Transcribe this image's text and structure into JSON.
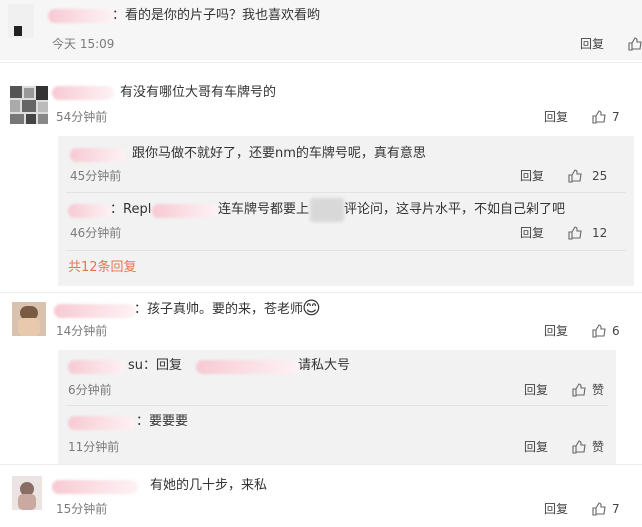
{
  "top_comment": {
    "text": "：看的是你的片子吗？我也喜欢看哟",
    "time": "今天 15:09",
    "reply_label": "回复"
  },
  "comments": [
    {
      "text": "有没有哪位大哥有车牌号的",
      "time": "54分钟前",
      "reply_label": "回复",
      "likes": "7",
      "replies": [
        {
          "text": "跟你马做不就好了，还要nm的车牌号呢，真有意思",
          "time": "45分钟前",
          "reply_label": "回复",
          "likes": "25"
        },
        {
          "text_a": "：Repl",
          "text_b": "连车牌号都要上",
          "text_c": "评论问，这寻片水平，不如自己剁了吧",
          "time": "46分钟前",
          "reply_label": "回复",
          "likes": "12"
        }
      ],
      "more_label": "共12条回复"
    },
    {
      "text": "：孩子真帅。要的来，苍老师",
      "emoji": "😊",
      "time": "14分钟前",
      "reply_label": "回复",
      "likes": "6",
      "replies": [
        {
          "text_a": "su：回复",
          "text_b": "请私大号",
          "time": "6分钟前",
          "reply_label": "回复",
          "likes": "赞"
        },
        {
          "text": "：要要要",
          "time": "11分钟前",
          "reply_label": "回复",
          "likes": "赞"
        }
      ]
    },
    {
      "text": "有她的几十步，来私",
      "time": "15分钟前",
      "reply_label": "回复",
      "likes": "7"
    }
  ]
}
